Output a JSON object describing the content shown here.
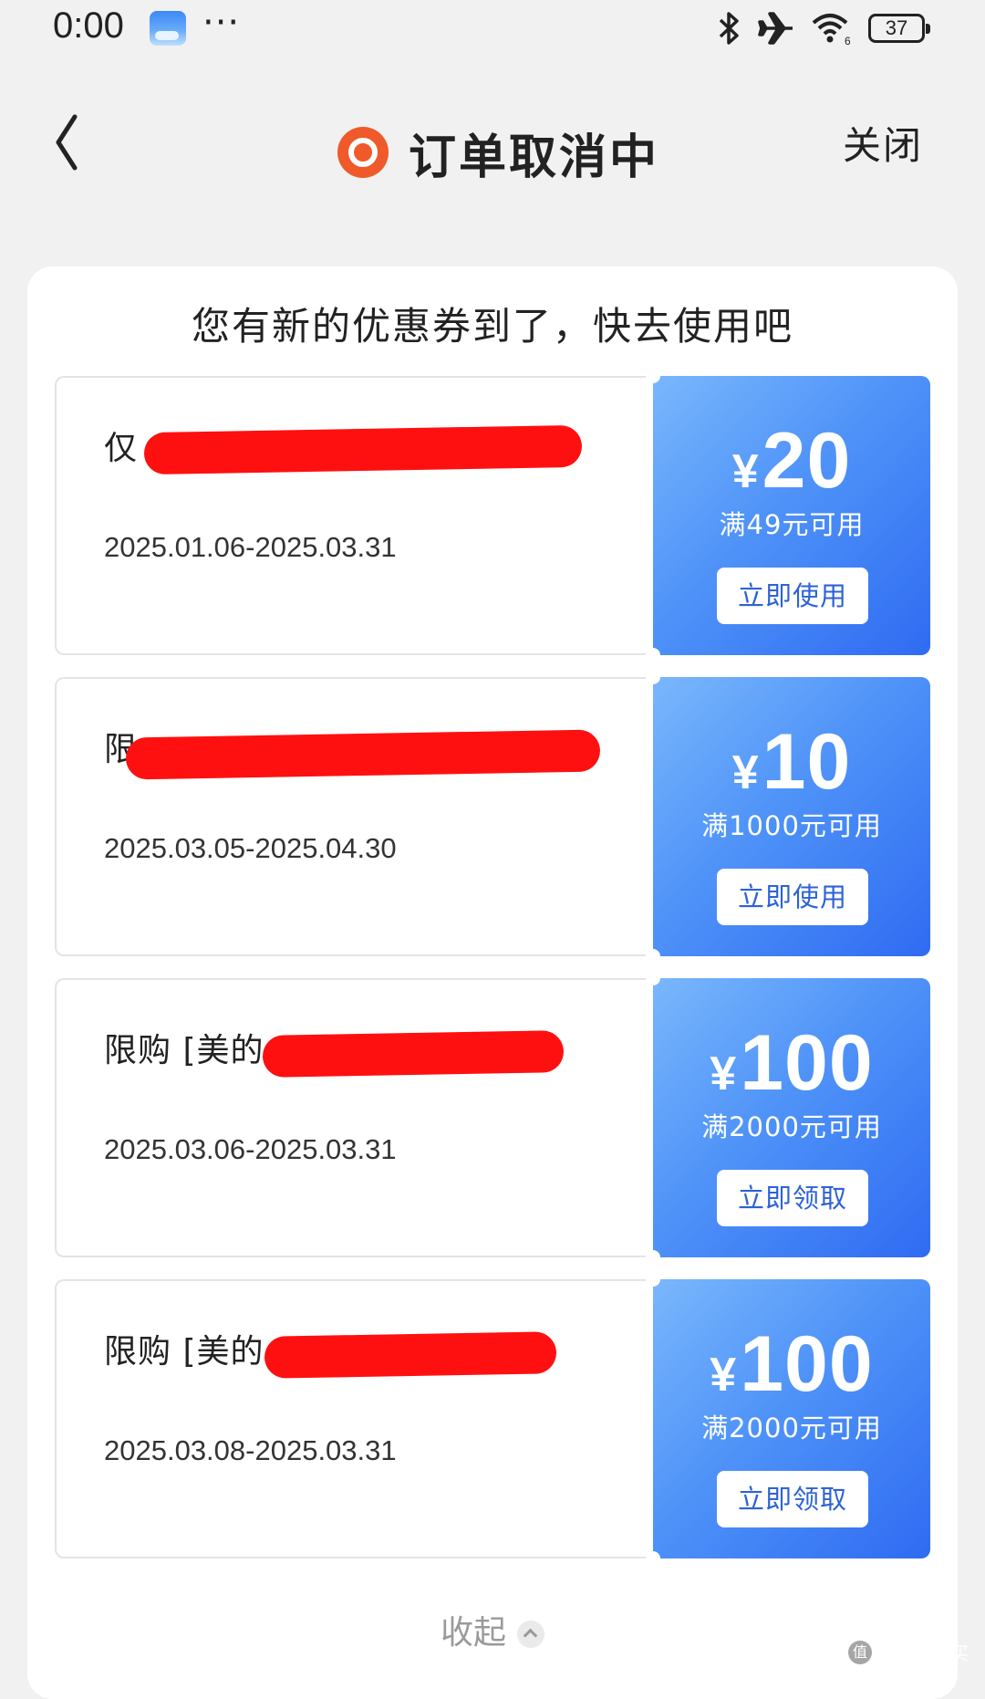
{
  "status_bar": {
    "time": "0:00",
    "more": "···",
    "battery": "37",
    "icons": [
      "photo-icon",
      "bluetooth-icon",
      "airplane-icon",
      "wifi-icon",
      "battery-icon"
    ]
  },
  "header": {
    "title": "订单取消中",
    "close": "关闭",
    "icons": [
      "back-icon",
      "cancel-status-icon"
    ]
  },
  "panel": {
    "title": "您有新的优惠券到了，快去使用吧",
    "collapse": "收起"
  },
  "coupons": [
    {
      "name": "仅               …",
      "date": "2025.01.06-2025.03.31",
      "currency": "¥",
      "amount": "20",
      "condition": "满49元可用",
      "button": "立即使用"
    },
    {
      "name": "限",
      "date": "2025.03.05-2025.04.30",
      "currency": "¥",
      "amount": "10",
      "condition": "满1000元可用",
      "button": "立即使用"
    },
    {
      "name": "限购 [美的                     …",
      "date": "2025.03.06-2025.03.31",
      "currency": "¥",
      "amount": "100",
      "condition": "满2000元可用",
      "button": "立即领取"
    },
    {
      "name": "限购 [美的                    品",
      "date": "2025.03.08-2025.03.31",
      "currency": "¥",
      "amount": "100",
      "condition": "满2000元可用",
      "button": "立即领取"
    }
  ],
  "watermark": {
    "badge": "值",
    "text": "什么值得买"
  },
  "colors": {
    "accent_orange": "#f05a2a",
    "coupon_blue": "#4f93f8",
    "button_text_blue": "#2c62d8",
    "redaction_red": "#ff1010"
  }
}
